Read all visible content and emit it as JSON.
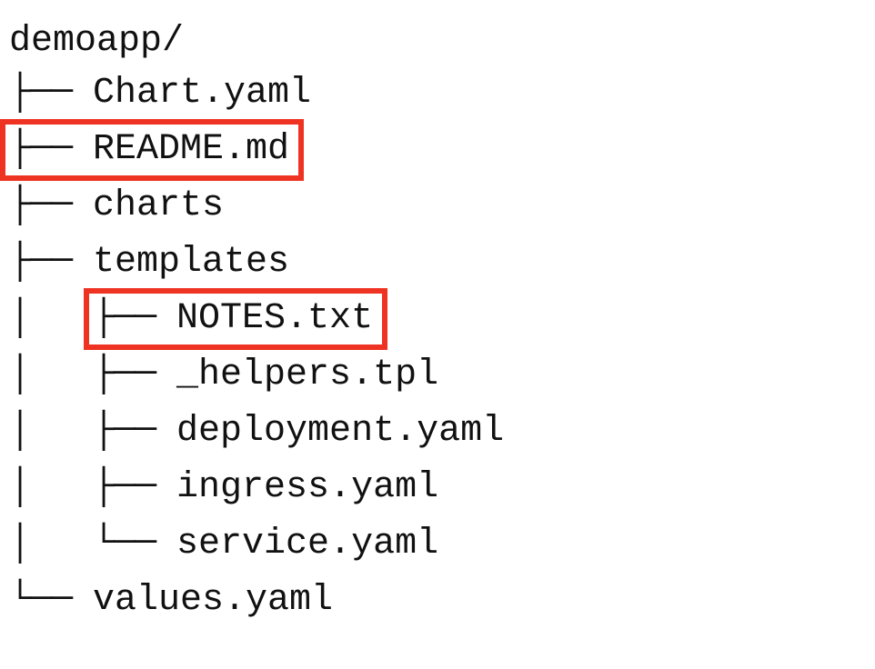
{
  "tree": {
    "root_label": "demoapp/",
    "items": [
      {
        "prefix": "├── ",
        "label": "Chart.yaml",
        "highlight": false,
        "include_prefix_in_highlight": false
      },
      {
        "prefix": "├── ",
        "label": "README.md",
        "highlight": true,
        "include_prefix_in_highlight": true
      },
      {
        "prefix": "├── ",
        "label": "charts",
        "highlight": false,
        "include_prefix_in_highlight": false
      },
      {
        "prefix": "├── ",
        "label": "templates",
        "highlight": false,
        "include_prefix_in_highlight": false
      },
      {
        "prefix": "│   ├── ",
        "label": "NOTES.txt",
        "highlight": true,
        "include_prefix_in_highlight": true
      },
      {
        "prefix": "│   ├── ",
        "label": "_helpers.tpl",
        "highlight": false,
        "include_prefix_in_highlight": false
      },
      {
        "prefix": "│   ├── ",
        "label": "deployment.yaml",
        "highlight": false,
        "include_prefix_in_highlight": false
      },
      {
        "prefix": "│   ├── ",
        "label": "ingress.yaml",
        "highlight": false,
        "include_prefix_in_highlight": false
      },
      {
        "prefix": "│   └── ",
        "label": "service.yaml",
        "highlight": false,
        "include_prefix_in_highlight": false
      },
      {
        "prefix": "└── ",
        "label": "values.yaml",
        "highlight": false,
        "include_prefix_in_highlight": false
      }
    ]
  },
  "highlight_color": "#ee3322"
}
